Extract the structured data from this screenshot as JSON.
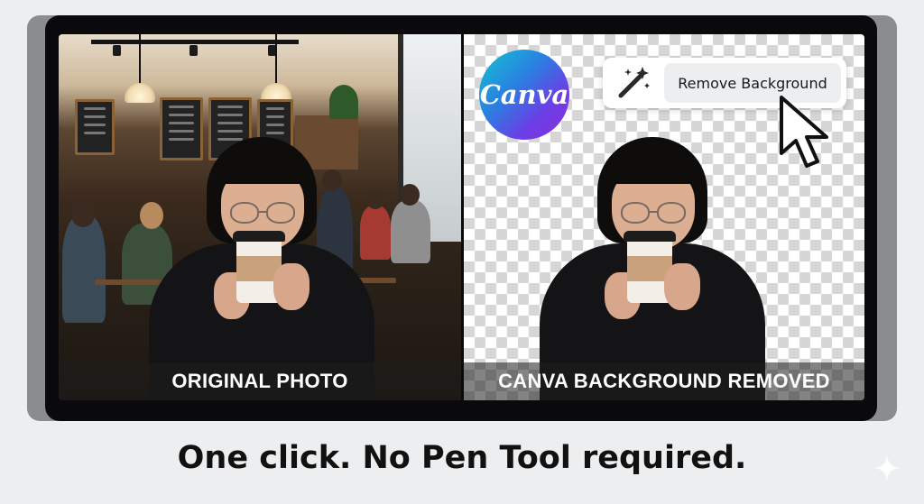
{
  "left_panel": {
    "caption": "ORIGINAL PHOTO"
  },
  "right_panel": {
    "caption": "CANVA BACKGROUND REMOVED"
  },
  "logo": {
    "text": "Canva"
  },
  "toolbar": {
    "icon": "magic-wand-icon",
    "button_label": "Remove Background"
  },
  "tagline": "One click. No Pen Tool required.",
  "colors": {
    "background": "#eceef0",
    "frame": "#0a0a0c",
    "logo_gradient_start": "#12c5d4",
    "logo_gradient_end": "#8a2fd8"
  },
  "icons": [
    "magic-wand-icon",
    "pointer-cursor-icon",
    "sparkle-icon"
  ]
}
